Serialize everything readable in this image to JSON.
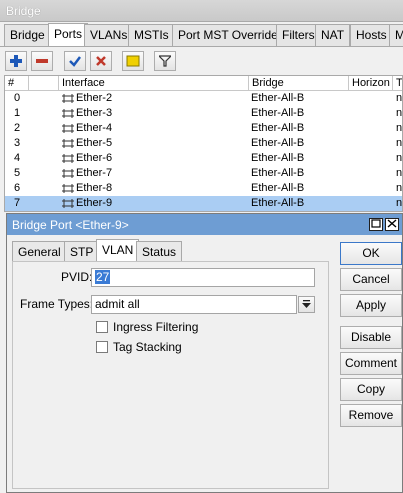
{
  "window": {
    "title": "Bridge"
  },
  "tabs": [
    "Bridge",
    "Ports",
    "VLANs",
    "MSTIs",
    "Port MST Overrides",
    "Filters",
    "NAT",
    "Hosts",
    "M"
  ],
  "toolbar": {
    "icons": [
      "add-icon",
      "remove-icon",
      "enable-icon",
      "disable-icon",
      "comment-icon",
      "filter-icon"
    ],
    "colors": {
      "add": "#1d58b8",
      "remove": "#c0392b",
      "enable": "#1d58b8",
      "disable": "#c0392b",
      "comment": "#f0d000"
    }
  },
  "table": {
    "headers": [
      "#",
      "",
      "Interface",
      "Bridge",
      "Horizon",
      "Tr"
    ],
    "rows": [
      {
        "num": "0",
        "interface": "Ether-2",
        "bridge": "Ether-All-B",
        "trusted": "no"
      },
      {
        "num": "1",
        "interface": "Ether-3",
        "bridge": "Ether-All-B",
        "trusted": "no"
      },
      {
        "num": "2",
        "interface": "Ether-4",
        "bridge": "Ether-All-B",
        "trusted": "no"
      },
      {
        "num": "3",
        "interface": "Ether-5",
        "bridge": "Ether-All-B",
        "trusted": "no"
      },
      {
        "num": "4",
        "interface": "Ether-6",
        "bridge": "Ether-All-B",
        "trusted": "no"
      },
      {
        "num": "5",
        "interface": "Ether-7",
        "bridge": "Ether-All-B",
        "trusted": "no"
      },
      {
        "num": "6",
        "interface": "Ether-8",
        "bridge": "Ether-All-B",
        "trusted": "no"
      },
      {
        "num": "7",
        "interface": "Ether-9",
        "bridge": "Ether-All-B",
        "trusted": "no"
      }
    ]
  },
  "dialog": {
    "title": "Bridge Port <Ether-9>",
    "tabs": [
      "General",
      "STP",
      "VLAN",
      "Status"
    ],
    "pvid_label": "PVID:",
    "pvid_value": "27",
    "frame_types_label": "Frame Types:",
    "frame_types_value": "admit all",
    "ingress_filtering": "Ingress Filtering",
    "tag_stacking": "Tag Stacking",
    "buttons": [
      "OK",
      "Cancel",
      "Apply",
      "Disable",
      "Comment",
      "Copy",
      "Remove"
    ]
  }
}
